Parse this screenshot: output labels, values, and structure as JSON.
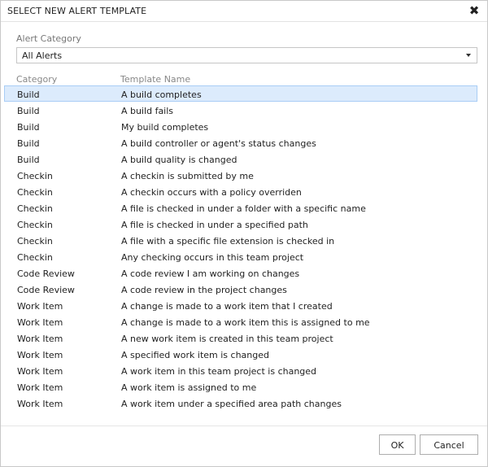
{
  "dialog": {
    "title": "SELECT NEW ALERT TEMPLATE",
    "close_glyph": "✖"
  },
  "category_filter": {
    "label": "Alert Category",
    "selected": "All Alerts"
  },
  "table": {
    "headers": [
      "Category",
      "Template Name"
    ],
    "selected_index": 0,
    "rows": [
      {
        "category": "Build",
        "name": "A build completes"
      },
      {
        "category": "Build",
        "name": "A build fails"
      },
      {
        "category": "Build",
        "name": "My build completes"
      },
      {
        "category": "Build",
        "name": "A build controller or agent's status changes"
      },
      {
        "category": "Build",
        "name": "A build quality is changed"
      },
      {
        "category": "Checkin",
        "name": "A checkin is submitted by me"
      },
      {
        "category": "Checkin",
        "name": "A checkin occurs with a policy overriden"
      },
      {
        "category": "Checkin",
        "name": "A file is checked in under a folder with a specific name"
      },
      {
        "category": "Checkin",
        "name": "A file is checked in under a specified path"
      },
      {
        "category": "Checkin",
        "name": "A file with a specific file extension is checked in"
      },
      {
        "category": "Checkin",
        "name": "Any checking occurs in this team project"
      },
      {
        "category": "Code Review",
        "name": "A code review I am working on changes"
      },
      {
        "category": "Code Review",
        "name": "A code review in the project changes"
      },
      {
        "category": "Work Item",
        "name": "A change is made to a work item that I created"
      },
      {
        "category": "Work Item",
        "name": "A change is made to a work item this is assigned to me"
      },
      {
        "category": "Work Item",
        "name": "A new work item is created in this team project"
      },
      {
        "category": "Work Item",
        "name": "A specified work item is changed"
      },
      {
        "category": "Work Item",
        "name": "A work item in this team project is changed"
      },
      {
        "category": "Work Item",
        "name": "A work item is assigned to me"
      },
      {
        "category": "Work Item",
        "name": "A work item under a specified area path changes"
      }
    ]
  },
  "buttons": {
    "ok": "OK",
    "cancel": "Cancel"
  },
  "colors": {
    "selected_row_bg": "#dcebfc",
    "selected_row_border": "#a9cdf5"
  }
}
